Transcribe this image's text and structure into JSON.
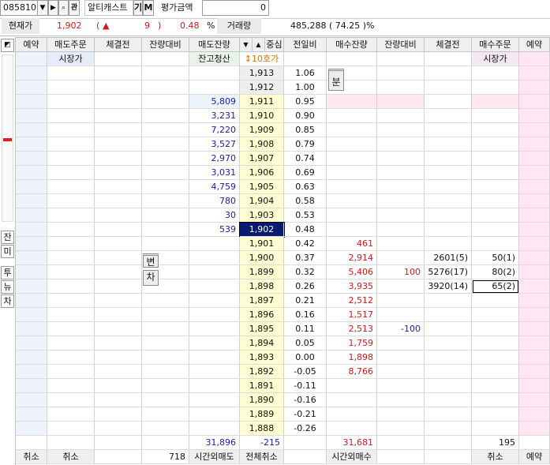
{
  "toolbar": {
    "code": "085810",
    "name": "알티캐스트",
    "tag_gi": "기",
    "tag_m": "M",
    "eval_label": "평가금액",
    "eval_value": "0",
    "icon_search": "search-icon",
    "icon_chart": "chart-icon"
  },
  "quote": {
    "price_label": "현재가",
    "price": "1,902",
    "change_open": "(",
    "change_arrow": "▲",
    "change": "9",
    "change_close": ")",
    "rate": "0.48",
    "pct": "%",
    "volume_label": "거래량",
    "volume": "485,288 ( 74.25 )%"
  },
  "headers": {
    "reserve_left": "예약",
    "sell_order": "매도주문",
    "filled_before_left": "체결전",
    "remain_diff_left": "잔량대비",
    "sell_remain": "매도잔량",
    "center": "중심",
    "prev_ratio": "전일비",
    "buy_remain": "매수잔량",
    "remain_diff_right": "잔량대비",
    "filled_before_right": "체결전",
    "buy_order": "매수주문",
    "reserve_right": "예약"
  },
  "subheader": {
    "sell_market": "시장가",
    "liquidate": "잔고청산",
    "range": "↕10호가",
    "buy_market": "시장가"
  },
  "side": {
    "tab_jan": "잔",
    "tab_mi": "미",
    "tab_tu": "투",
    "tab_nyu": "뉴",
    "tab_cha": "차",
    "top_icon": "pin-icon"
  },
  "badges": {
    "bun": "분",
    "byeon": "변",
    "cha": "차"
  },
  "asks": [
    {
      "price": "1,913",
      "ratio": "1.06",
      "qty": ""
    },
    {
      "price": "1,912",
      "ratio": "1.00",
      "qty": ""
    },
    {
      "price": "1,911",
      "ratio": "0.95",
      "qty": "5,809"
    },
    {
      "price": "1,910",
      "ratio": "0.90",
      "qty": "3,231"
    },
    {
      "price": "1,909",
      "ratio": "0.85",
      "qty": "7,220"
    },
    {
      "price": "1,908",
      "ratio": "0.79",
      "qty": "3,527"
    },
    {
      "price": "1,907",
      "ratio": "0.74",
      "qty": "2,970"
    },
    {
      "price": "1,906",
      "ratio": "0.69",
      "qty": "3,031"
    },
    {
      "price": "1,905",
      "ratio": "0.63",
      "qty": "4,759"
    },
    {
      "price": "1,904",
      "ratio": "0.58",
      "qty": "780"
    },
    {
      "price": "1,903",
      "ratio": "0.53",
      "qty": "30"
    },
    {
      "price": "1,902",
      "ratio": "0.48",
      "qty": "539"
    }
  ],
  "bids": [
    {
      "price": "1,901",
      "ratio": "0.42",
      "qty": "461",
      "diff": "",
      "filled": "",
      "order": ""
    },
    {
      "price": "1,900",
      "ratio": "0.37",
      "qty": "2,914",
      "diff": "",
      "filled": "2601(5)",
      "order": "50(1)"
    },
    {
      "price": "1,899",
      "ratio": "0.32",
      "qty": "5,406",
      "diff": "100",
      "filled": "5276(17)",
      "order": "80(2)"
    },
    {
      "price": "1,898",
      "ratio": "0.26",
      "qty": "3,935",
      "diff": "",
      "filled": "3920(14)",
      "order": "65(2)"
    },
    {
      "price": "1,897",
      "ratio": "0.21",
      "qty": "2,512",
      "diff": "",
      "filled": "",
      "order": ""
    },
    {
      "price": "1,896",
      "ratio": "0.16",
      "qty": "1,517",
      "diff": "",
      "filled": "",
      "order": ""
    },
    {
      "price": "1,895",
      "ratio": "0.11",
      "qty": "2,513",
      "diff": "-100",
      "filled": "",
      "order": ""
    },
    {
      "price": "1,894",
      "ratio": "0.05",
      "qty": "1,759",
      "diff": "",
      "filled": "",
      "order": ""
    },
    {
      "price": "1,893",
      "ratio": "0.00",
      "qty": "1,898",
      "diff": "",
      "filled": "",
      "order": ""
    },
    {
      "price": "1,892",
      "ratio": "-0.05",
      "qty": "8,766",
      "diff": "",
      "filled": "",
      "order": ""
    },
    {
      "price": "1,891",
      "ratio": "-0.11",
      "qty": "",
      "diff": "",
      "filled": "",
      "order": ""
    },
    {
      "price": "1,890",
      "ratio": "-0.16",
      "qty": "",
      "diff": "",
      "filled": "",
      "order": ""
    },
    {
      "price": "1,889",
      "ratio": "-0.21",
      "qty": "",
      "diff": "",
      "filled": "",
      "order": ""
    },
    {
      "price": "1,888",
      "ratio": "-0.26",
      "qty": "",
      "diff": "",
      "filled": "",
      "order": ""
    }
  ],
  "totals": {
    "sell_total": "31,896",
    "center_diff": "-215",
    "buy_total": "31,681",
    "buy_order_total": "195"
  },
  "footer": {
    "cancel1": "취소",
    "cancel2": "취소",
    "num": "718",
    "after_hours_sell": "시간외매도",
    "cancel_all": "전체취소",
    "after_hours_buy": "시간외매수",
    "cancel3": "취소",
    "reserve": "예약"
  },
  "colors": {
    "ask_price_bg": "#fffdd2",
    "current_bg": "#0a1a6e",
    "buy_pink": "#ffe6f2",
    "header_bg": "#efefef"
  }
}
